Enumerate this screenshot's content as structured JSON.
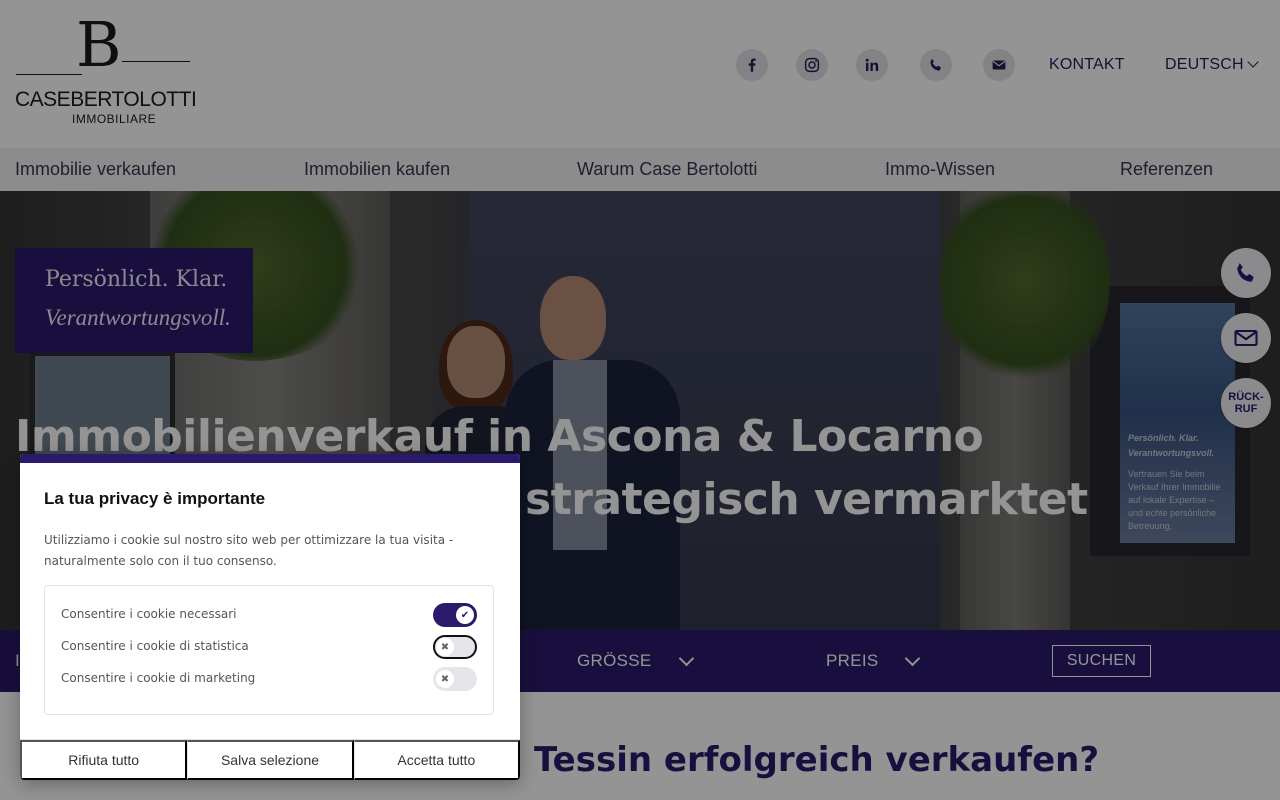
{
  "brand": {
    "monogram": "B",
    "name_left": "CASE",
    "name_right": "BERTOLOTTI",
    "subtitle": "IMMOBILIARE"
  },
  "header": {
    "social_icons": [
      "facebook-icon",
      "instagram-icon",
      "linkedin-icon",
      "phone-icon",
      "mail-icon"
    ],
    "contact_label": "KONTAKT",
    "language_label": "DEUTSCH"
  },
  "nav": {
    "items": [
      {
        "label": "Immobilie verkaufen"
      },
      {
        "label": "Immobilien kaufen"
      },
      {
        "label": "Warum Case Bertolotti"
      },
      {
        "label": "Immo-Wissen"
      },
      {
        "label": "Referenzen"
      }
    ]
  },
  "hero": {
    "tagline_line1": "Persönlich. Klar.",
    "tagline_line2": "Verantwortungsvoll.",
    "headline_line1": "Immobilienverkauf in Ascona & Locarno",
    "headline_line2": "strategisch vermarktet",
    "poster": {
      "line1": "Persönlich. Klar.",
      "line2": "Verantwortungsvoll.",
      "line3": "Vertrauen Sie beim",
      "line4": "Verkauf Ihrer Immobilie",
      "line5": "auf lokale Expertise –",
      "line6": "und echte persönliche",
      "line7": "Betreuung."
    },
    "callback_label_1": "RÜCK-",
    "callback_label_2": "RUF"
  },
  "search": {
    "first_label": "I",
    "size_label": "GRÖSSE",
    "price_label": "PREIS",
    "submit_label": "SUCHEN"
  },
  "section": {
    "title": "Tessin erfolgreich verkaufen?"
  },
  "cookie_modal": {
    "title": "La tua privacy è importante",
    "description": "Utilizziamo i cookie sul nostro sito web per ottimizzare la tua visita - naturalmente solo con il tuo consenso.",
    "options": [
      {
        "label": "Consentire i cookie necessari",
        "enabled": true
      },
      {
        "label": "Consentire i cookie di statistica",
        "enabled": false
      },
      {
        "label": "Consentire i cookie di marketing",
        "enabled": false
      }
    ],
    "reject_label": "Rifiuta tutto",
    "save_label": "Salva selezione",
    "accept_label": "Accetta tutto"
  },
  "colors": {
    "brand_purple": "#2b1a6b",
    "text_dark": "#2b1a56"
  }
}
